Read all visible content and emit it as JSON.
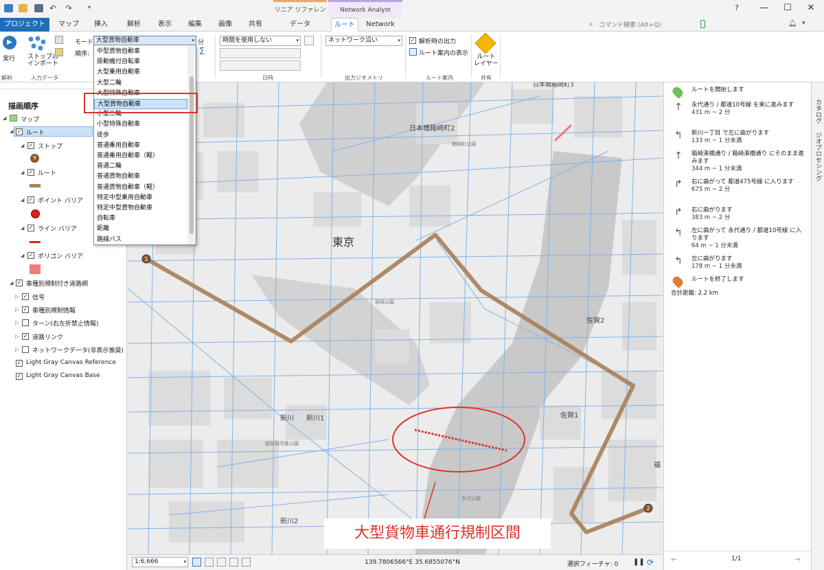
{
  "title_bar": {
    "context_groups": [
      {
        "label": "リニア リファレンス",
        "color": "#e6a96b"
      },
      {
        "label": "Network Analyst",
        "color": "#b9a4e0"
      }
    ],
    "help": "?",
    "minimize": "—",
    "maximize": "☐",
    "close": "✕"
  },
  "tabs": {
    "project": "プロジェクト",
    "items": [
      "マップ",
      "挿入",
      "解析",
      "表示",
      "編集",
      "画像",
      "共有",
      "データ",
      "ルート",
      "Network"
    ],
    "active": "ルート",
    "command_search_placeholder": "コマンド検索 (Alt+Q)"
  },
  "ribbon": {
    "run_label": "実行",
    "import_stops_label": "ストップの\nインポート",
    "mode_label": "モード:",
    "mode_value": "大型貨物自動車",
    "order_label": "順序:",
    "minutes_label": "分",
    "time_value": "時間を使用しない",
    "output_geometry_value": "ネットワーク沿い",
    "output_on_solve": "解析時の出力",
    "show_directions": "ルート案内の表示",
    "route_layer": "ルート\nレイヤー",
    "groups": [
      "解析",
      "入力データ",
      "日時",
      "出力ジオメトリ",
      "ルート案内",
      "共有"
    ]
  },
  "mode_dropdown": {
    "items": [
      "中型貨物自動車",
      "原動機付自転車",
      "大型乗用自動車",
      "大型二輪",
      "大型特殊自動車",
      "大型貨物自動車",
      "小型二輪",
      "小型特殊自動車",
      "徒歩",
      "普通乗用自動車",
      "普通乗用自動車（軽）",
      "普通二輪",
      "普通貨物自動車",
      "普通貨物自動車（軽）",
      "特定中型乗用自動車",
      "特定中型貨物自動車",
      "自転車",
      "距離",
      "路線バス"
    ],
    "selected": "大型貨物自動車"
  },
  "contents": {
    "heading": "描画順序",
    "map": "マップ",
    "route_layer": "ルート",
    "stops": "ストップ",
    "stop_badge": "9",
    "route": "ルート",
    "point_barrier": "ポイント バリア",
    "line_barrier": "ライン バリア",
    "polygon_barrier": "ポリゴン バリア",
    "network": "車種別規制付き道路網",
    "signal": "信号",
    "vehicle_info": "車種別規制情報",
    "turn": "ターン(右左折禁止情報)",
    "road_link": "道路リンク",
    "network_data": "ネットワークデータ(非表示推奨)",
    "canvas_ref": "Light Gray Canvas Reference",
    "canvas_base": "Light Gray Canvas Base",
    "colors": {
      "route": "#a97f5a",
      "point_barrier": "#e0201e",
      "line_barrier": "#e0201e",
      "polygon_barrier": "#f07b7b"
    }
  },
  "map": {
    "labels": [
      "日本橋箱崎町3",
      "日本橋箱崎町2",
      "箱崎町公園",
      "東京",
      "坂崎公園",
      "佐賀2",
      "佐賀1",
      "新川",
      "新川1",
      "新川2",
      "越前堀児童公園",
      "永代公園",
      "福"
    ],
    "stop_start": "1",
    "stop_end": "2",
    "caption": "大型貨物車通行規制区間",
    "route_color": "#a97f5a",
    "barrier_color": "#e0302b"
  },
  "status": {
    "scale": "1:6,666",
    "coords": "139.7806566°E 35.6855076°N",
    "selected": "選択フィーチャ: 0"
  },
  "directions": {
    "items": [
      {
        "icon": "start",
        "text": "ルートを開始します",
        "sub": ""
      },
      {
        "icon": "up",
        "text": "永代通り / 都道10号線 を東に進みます",
        "sub": "431 m ~ 2 分"
      },
      {
        "icon": "left",
        "text": "新川一丁目 で左に曲がります",
        "sub": "133 m ~ 1 分未満"
      },
      {
        "icon": "up",
        "text": "箱崎湊橋通り / 箱崎湊橋通り にそのまま進みます",
        "sub": "344 m ~ 1 分未満"
      },
      {
        "icon": "right",
        "text": "右に曲がって 都道475号線 に入ります",
        "sub": "675 m ~ 2 分"
      },
      {
        "icon": "right",
        "text": "右に曲がります",
        "sub": "383 m ~ 2 分"
      },
      {
        "icon": "left",
        "text": "左に曲がって 永代通り / 都道10号線 に入ります",
        "sub": "64 m ~ 1 分未満"
      },
      {
        "icon": "left",
        "text": "左に曲がります",
        "sub": "178 m ~ 1 分未満"
      },
      {
        "icon": "end",
        "text": "ルートを終了します",
        "sub": ""
      }
    ],
    "total": "合計距離: 2.2 km",
    "page": "1/1"
  },
  "side_tabs": [
    "カタログ",
    "ジオプロセシング"
  ]
}
